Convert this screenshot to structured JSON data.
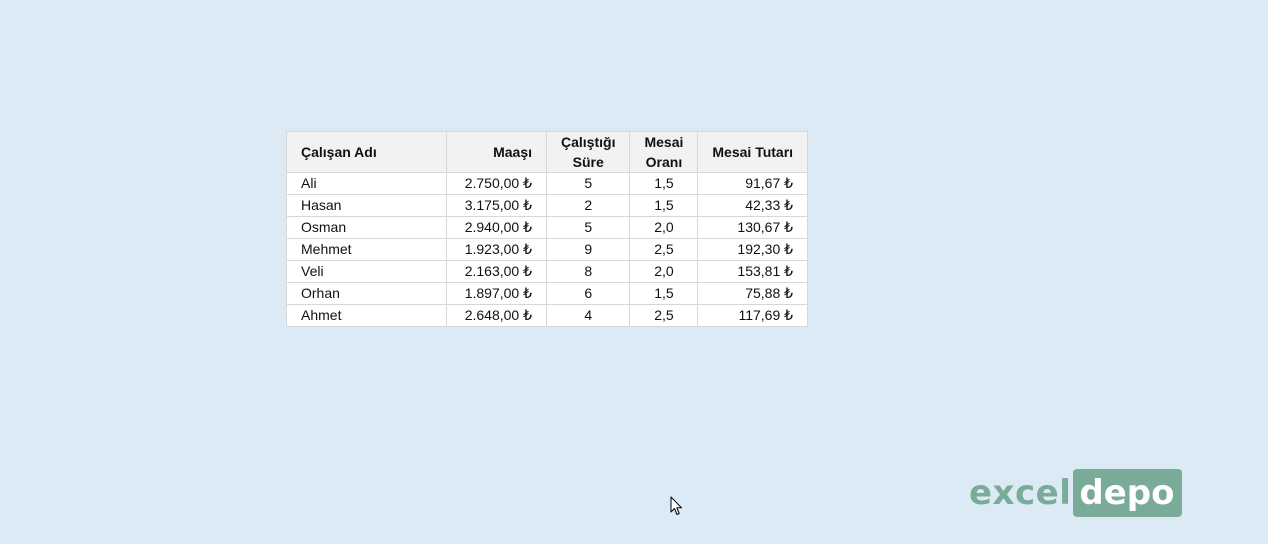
{
  "table": {
    "headers": [
      {
        "line1": "Çalışan Adı",
        "line2": ""
      },
      {
        "line1": "Maaşı",
        "line2": ""
      },
      {
        "line1": "Çalıştığı",
        "line2": "Süre"
      },
      {
        "line1": "Mesai",
        "line2": "Oranı"
      },
      {
        "line1": "Mesai Tutarı",
        "line2": ""
      }
    ],
    "rows": [
      [
        "Ali",
        "2.750,00 ₺",
        "5",
        "1,5",
        "91,67 ₺"
      ],
      [
        "Hasan",
        "3.175,00 ₺",
        "2",
        "1,5",
        "42,33 ₺"
      ],
      [
        "Osman",
        "2.940,00 ₺",
        "5",
        "2,0",
        "130,67 ₺"
      ],
      [
        "Mehmet",
        "1.923,00 ₺",
        "9",
        "2,5",
        "192,30 ₺"
      ],
      [
        "Veli",
        "2.163,00 ₺",
        "8",
        "2,0",
        "153,81 ₺"
      ],
      [
        "Orhan",
        "1.897,00 ₺",
        "6",
        "1,5",
        "75,88 ₺"
      ],
      [
        "Ahmet",
        "2.648,00 ₺",
        "4",
        "2,5",
        "117,69 ₺"
      ]
    ]
  },
  "logo": {
    "part1": "excel",
    "part2": "depo",
    "color": "#7aab98"
  },
  "cursor": {
    "icon": "mouse-pointer-icon"
  }
}
